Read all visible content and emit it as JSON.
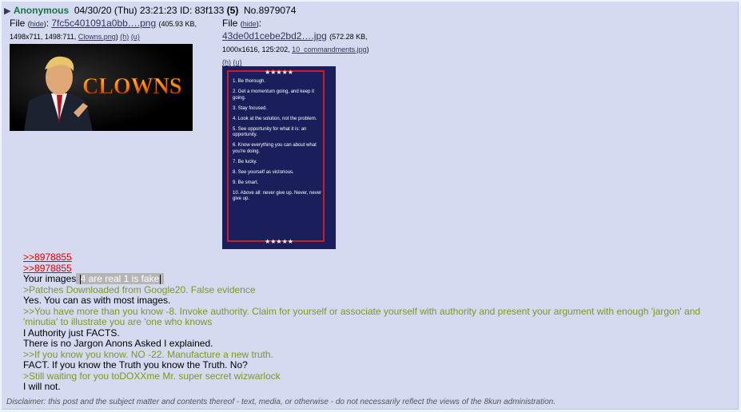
{
  "post": {
    "name": "Anonymous",
    "date": "04/30/20 (Thu) 23:21:23",
    "id_label": "ID: 83f133",
    "post_count": "(5)",
    "post_no": "No.8979074"
  },
  "files": [
    {
      "label": "File",
      "hide": "hide",
      "filename": "7fc5c401091a0bb….png",
      "meta": "(405.93 KB, 1498x711, 1498:711,",
      "orig_name": "Clowns.png",
      "h": "(h)",
      "u": "(u)",
      "image_text": "CLOWNS"
    },
    {
      "label": "File",
      "hide": "hide",
      "filename": "43de0d1cebe2bd2….jpg",
      "meta": "(572.28 KB, 1000x1616, 125:202,",
      "orig_name": "10_commandments.jpg",
      "h": "(h)",
      "u": "(u)",
      "stars": "★★★★★",
      "list": [
        "1. Be thorough.",
        "2. Get a momentum going, and keep it going.",
        "3. Stay focused.",
        "4. Look at the solution, not the problem.",
        "5. See opportunity for what it is: an opportunity.",
        "6. Know everything you can about what you're doing.",
        "7. Be lucky.",
        "8. See yourself as victorious.",
        "9. Be smart.",
        "10. Above all: never give up. Never, never give up."
      ]
    }
  ],
  "body": {
    "link1": ">>8978855",
    "link2": ">>8978855",
    "your_images": "Your images",
    "spoiler": "4 are real 1 is fake",
    "q1": ">Patches Downloaded from Google20. False evidence",
    "l1": "Yes. You can as with most images.",
    "q2": ">>You have more than you know -8. Invoke authority. Claim for yourself or associate yourself with authority and present your argument with enough 'jargon' and 'minutia' to illustrate you are 'one who knows",
    "l2": "I Authority just FACTS.",
    "l3": "There is no Jargon Anons Asked I explained.",
    "q3": ">>If you know you know. NO -22. Manufacture a new truth.",
    "l4": "FACT. If you know the Truth you know the Truth. No?",
    "q4": ">Still waiting for you toDOXXme Mr. super secret wizwarlock",
    "l5": "I will not."
  },
  "disclaimer": "Disclaimer: this post and the subject matter and contents thereof - text, media, or otherwise - do not necessarily reflect the views of the 8kun administration.",
  "colors": {
    "background": "#eef2ff",
    "post_bg": "#d6daf0",
    "name": "#117743",
    "link": "#d00000",
    "greentext": "#789922"
  }
}
